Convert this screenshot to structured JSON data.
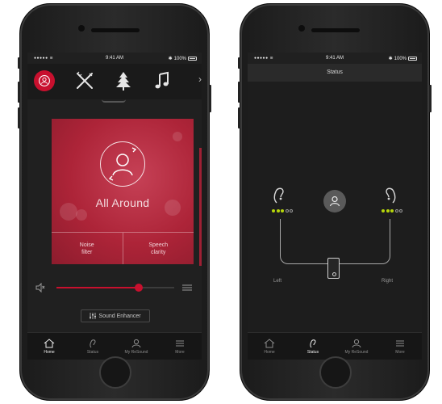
{
  "left_phone": {
    "status_bar": {
      "signal": "●●●●● ≋",
      "time": "9:41 AM",
      "bluetooth": "✱",
      "battery": "100%"
    },
    "programs": [
      {
        "icon": "person-ring-icon",
        "active": true
      },
      {
        "icon": "fork-knife-icon",
        "active": false
      },
      {
        "icon": "tree-icon",
        "active": false
      },
      {
        "icon": "music-note-icon",
        "active": false
      }
    ],
    "program_more": "›",
    "card": {
      "title": "All Around",
      "options": [
        "Noise\nfilter",
        "Speech\nclarity"
      ]
    },
    "volume": {
      "level": 0.7
    },
    "enhancer_button": "Sound Enhancer",
    "tabs": [
      {
        "label": "Home",
        "icon": "home-icon",
        "active": true
      },
      {
        "label": "Status",
        "icon": "hearing-aid-icon",
        "active": false
      },
      {
        "label": "My ReSound",
        "icon": "user-icon",
        "active": false
      },
      {
        "label": "More",
        "icon": "menu-icon",
        "active": false
      }
    ]
  },
  "right_phone": {
    "status_bar": {
      "signal": "●●●●● ≋",
      "time": "9:41 AM",
      "bluetooth": "✱",
      "battery": "100%"
    },
    "header_title": "Status",
    "left_aid": {
      "label": "Left",
      "battery_level": 3,
      "battery_max": 5
    },
    "right_aid": {
      "label": "Right",
      "battery_level": 3,
      "battery_max": 5
    },
    "tabs": [
      {
        "label": "Home",
        "icon": "home-icon",
        "active": false
      },
      {
        "label": "Status",
        "icon": "hearing-aid-icon",
        "active": true
      },
      {
        "label": "My ReSound",
        "icon": "user-icon",
        "active": false
      },
      {
        "label": "More",
        "icon": "menu-icon",
        "active": false
      }
    ]
  },
  "colors": {
    "accent": "#c8102e",
    "battery_on": "#b6d50b"
  }
}
